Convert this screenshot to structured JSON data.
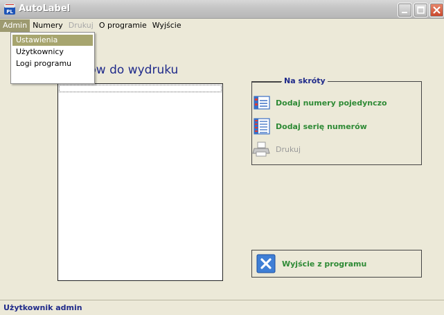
{
  "window": {
    "title": "AutoLabel"
  },
  "menu": {
    "items": [
      {
        "label": "Admin",
        "state": "active"
      },
      {
        "label": "Numery",
        "state": "normal"
      },
      {
        "label": "Drukuj",
        "state": "disabled"
      },
      {
        "label": "O programie",
        "state": "normal"
      },
      {
        "label": "Wyjście",
        "state": "normal"
      }
    ],
    "admin_dropdown": [
      "Ustawienia",
      "Użytkownicy",
      "Logi programu"
    ]
  },
  "main": {
    "list_title": "umerów do wydruku"
  },
  "shortcuts": {
    "legend": "Na skróty",
    "items": [
      {
        "label": "Dodaj numery pojedynczo",
        "icon": "list-single-icon",
        "enabled": true
      },
      {
        "label": "Dodaj serię numerów",
        "icon": "list-series-icon",
        "enabled": true
      },
      {
        "label": "Drukuj",
        "icon": "printer-icon",
        "enabled": false
      }
    ]
  },
  "exit": {
    "label": "Wyjście z programu",
    "icon": "close-x-icon"
  },
  "status": {
    "text": "Użytkownik admin"
  },
  "colors": {
    "accent_blue": "#1f2a8a",
    "action_green": "#2e8a35",
    "menu_highlight": "#a7a56f",
    "face": "#ece9d8"
  }
}
